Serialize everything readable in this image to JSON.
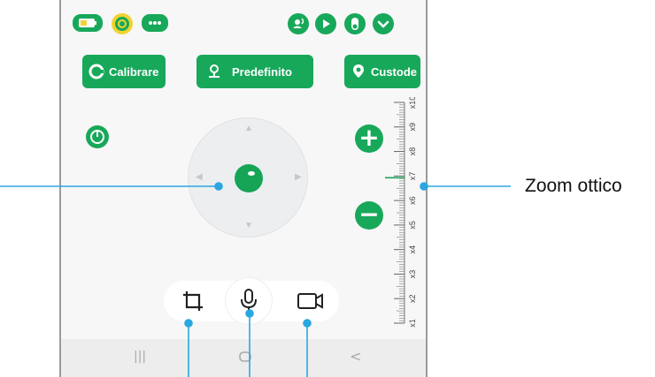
{
  "colors": {
    "accent": "#18a85a",
    "callout_line": "#2aa7e0",
    "phone_bg": "#f7f7f7"
  },
  "status_icons": [
    "battery-icon",
    "power-ring-icon",
    "signal-dots-icon",
    "user-wave-icon",
    "play-icon",
    "toggle-icon",
    "chevron-down-icon"
  ],
  "toolbar": {
    "calibrate_label": "Calibrare",
    "preset_label": "Predefinito",
    "guard_label": "Custode"
  },
  "zoom": {
    "ticks": [
      "x1",
      "x2",
      "x3",
      "x4",
      "x5",
      "x6",
      "x7",
      "x8",
      "x9",
      "x10"
    ],
    "current_level": 7
  },
  "controls": {
    "zoom_in_symbol": "+",
    "zoom_out_symbol": "−"
  },
  "bottom_icons": [
    "crop-icon",
    "microphone-icon",
    "video-record-icon"
  ],
  "navbar": {
    "recents_symbol": "|||",
    "back_symbol": "<"
  },
  "callouts": {
    "zoom_label": "Zoom ottico"
  }
}
